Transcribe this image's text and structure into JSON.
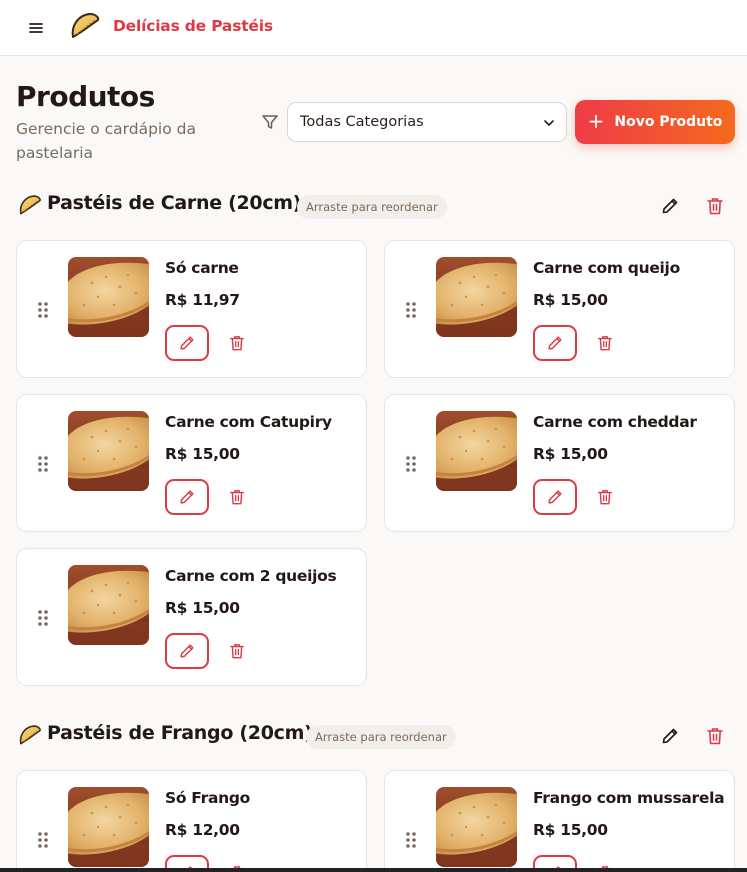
{
  "header": {
    "brand": "Delícias de Pastéis",
    "menu_icon": "hamburger-menu-icon",
    "logo_icon": "pastel-logo-icon"
  },
  "page": {
    "title": "Produtos",
    "subtitle": "Gerencie o cardápio da pastelaria"
  },
  "filter": {
    "icon": "filter-icon",
    "selected": "Todas Categorias"
  },
  "actions": {
    "new_product": "Novo Produto"
  },
  "colors": {
    "brand": "#dc3a44",
    "accent_start": "#ef3b48",
    "accent_end": "#f46a1e",
    "background": "#faf9f7"
  },
  "categories": [
    {
      "title": "Pastéis de Carne (20cm)",
      "hint": "Arraste para reordenar",
      "products": [
        {
          "name": "Só carne",
          "price": "R$ 11,97"
        },
        {
          "name": "Carne com queijo",
          "price": "R$ 15,00"
        },
        {
          "name": "Carne com Catupiry",
          "price": "R$ 15,00"
        },
        {
          "name": "Carne com cheddar",
          "price": "R$ 15,00"
        },
        {
          "name": "Carne com 2 queijos",
          "price": "R$ 15,00"
        }
      ]
    },
    {
      "title": "Pastéis de Frango (20cm)",
      "hint": "Arraste para reordenar",
      "products": [
        {
          "name": "Só Frango",
          "price": "R$ 12,00"
        },
        {
          "name": "Frango com mussarela",
          "price": "R$ 15,00"
        }
      ]
    }
  ]
}
